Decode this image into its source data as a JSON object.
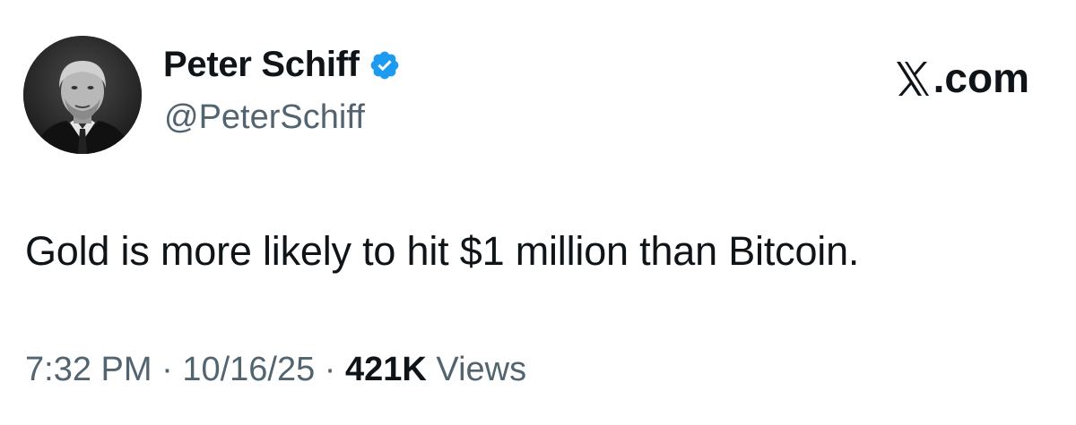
{
  "tweet": {
    "author": {
      "display_name": "Peter Schiff",
      "handle": "@PeterSchiff",
      "verified": true,
      "avatar_icon": "profile-photo"
    },
    "brand": {
      "label": ".com",
      "logo_icon": "x-logo-icon"
    },
    "text": "Gold is more likely to hit $1 million than Bitcoin.",
    "meta": {
      "time": "7:32 PM",
      "separator": " · ",
      "date": "10/16/25",
      "views_count": "421K",
      "views_label": " Views"
    }
  },
  "colors": {
    "text": "#0f1419",
    "secondary": "#536471",
    "verified_badge": "#1d9bf0"
  }
}
